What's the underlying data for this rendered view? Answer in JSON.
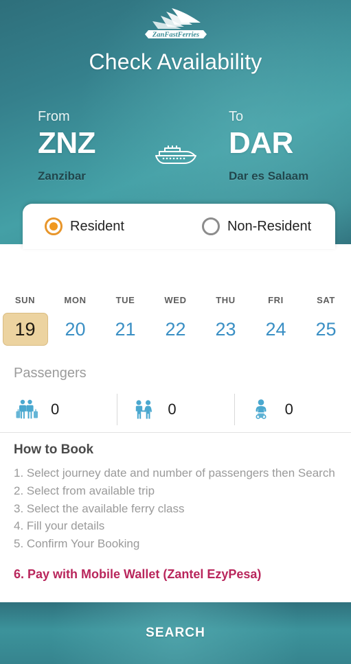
{
  "header": {
    "logo_text": "ZanFastFerries",
    "logo_icon": "ferry-logo-icon",
    "title": "Check Availability"
  },
  "route": {
    "from_label": "From",
    "from_code": "ZNZ",
    "from_city": "Zanzibar",
    "to_label": "To",
    "to_code": "DAR",
    "to_city": "Dar es Salaam",
    "transport_icon": "ferry-icon"
  },
  "residency": {
    "options": [
      {
        "label": "Resident",
        "selected": true
      },
      {
        "label": "Non-Resident",
        "selected": false
      }
    ],
    "selected_color": "#f0981f"
  },
  "dates": {
    "selected_index": 0,
    "selected_bg": "#ecd3a0",
    "number_color": "#3a8fc4",
    "items": [
      {
        "dow": "SUN",
        "day": "19"
      },
      {
        "dow": "MON",
        "day": "20"
      },
      {
        "dow": "TUE",
        "day": "21"
      },
      {
        "dow": "WED",
        "day": "22"
      },
      {
        "dow": "THU",
        "day": "23"
      },
      {
        "dow": "FRI",
        "day": "24"
      },
      {
        "dow": "SAT",
        "day": "25"
      }
    ]
  },
  "passengers": {
    "title": "Passengers",
    "icon_color": "#4aa8cf",
    "items": [
      {
        "icon": "adults-with-luggage-icon",
        "count": "0"
      },
      {
        "icon": "children-icon",
        "count": "0"
      },
      {
        "icon": "infant-icon",
        "count": "0"
      }
    ]
  },
  "how_to_book": {
    "title": "How to Book",
    "steps": [
      "1. Select journey date and number of passengers then Search",
      "2. Select from available trip",
      "3. Select the available ferry class",
      "4. Fill your details",
      "5. Confirm Your Booking"
    ],
    "highlight_step": "6. Pay with Mobile Wallet (Zantel EzyPesa)",
    "highlight_color": "#b9265c"
  },
  "footer": {
    "search_label": "SEARCH"
  }
}
